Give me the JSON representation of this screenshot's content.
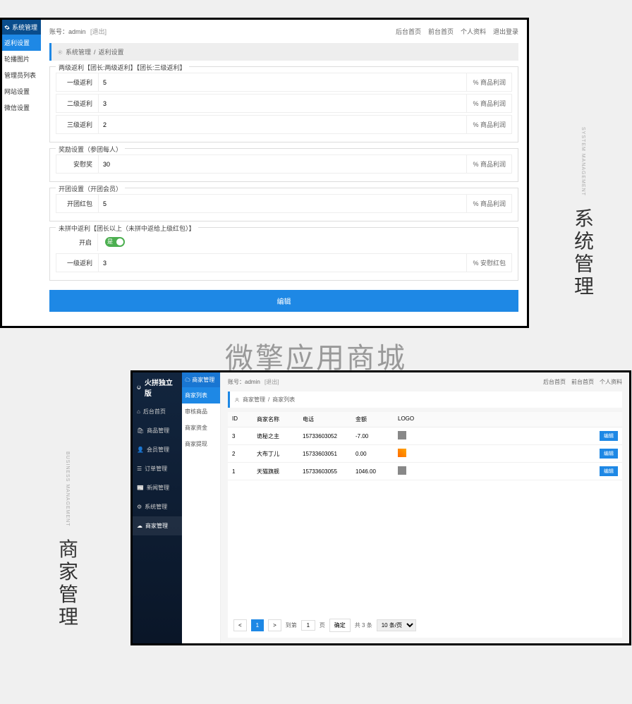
{
  "panel1": {
    "sidebar": {
      "header": "系统管理",
      "items": [
        "返利设置",
        "轮播图片",
        "管理员列表",
        "网站设置",
        "微信设置"
      ]
    },
    "topbar": {
      "account_label": "账号：",
      "account_value": "admin",
      "logout_inline": "[退出]",
      "links": [
        "后台首页",
        "前台首页",
        "个人资料",
        "退出登录"
      ]
    },
    "breadcrumb": [
      "系统管理",
      "返利设置"
    ],
    "section1": {
      "title": "两级返利【团长:两级返利】【团长:三级返利】",
      "rows": [
        {
          "label": "一级返利",
          "value": "5",
          "suffix": "% 商品利润"
        },
        {
          "label": "二级返利",
          "value": "3",
          "suffix": "% 商品利润"
        },
        {
          "label": "三级返利",
          "value": "2",
          "suffix": "% 商品利润"
        }
      ]
    },
    "section2": {
      "title": "奖励设置（参团每人）",
      "rows": [
        {
          "label": "安慰奖",
          "value": "30",
          "suffix": "% 商品利润"
        }
      ]
    },
    "section3": {
      "title": "开团设置（开团会员）",
      "rows": [
        {
          "label": "开团红包",
          "value": "5",
          "suffix": "% 商品利润"
        }
      ]
    },
    "section4": {
      "title": "未拼中返利【团长以上（未拼中返给上级红包）】",
      "toggle_label": "开启",
      "toggle_text": "是",
      "rows": [
        {
          "label": "一级返利",
          "value": "3",
          "suffix": "% 安慰红包"
        }
      ]
    },
    "submit": "编辑"
  },
  "vlabel1": {
    "cn": "系统管理",
    "en": "SYSTEM MANAGEMENT"
  },
  "center_text": "微擎应用商城",
  "panel2": {
    "brand": "火拼独立版",
    "nav": [
      {
        "icon": "home",
        "label": "后台首页"
      },
      {
        "icon": "bag",
        "label": "商品管理"
      },
      {
        "icon": "user",
        "label": "会员管理"
      },
      {
        "icon": "list",
        "label": "订单管理"
      },
      {
        "icon": "news",
        "label": "新闻管理"
      },
      {
        "icon": "gear",
        "label": "系统管理"
      },
      {
        "icon": "cloud",
        "label": "商家管理"
      }
    ],
    "subsidebar": {
      "header": "商家管理",
      "items": [
        "商家列表",
        "审核商品",
        "商家资金",
        "商家提现"
      ]
    },
    "topbar": {
      "account_label": "账号：",
      "account_value": "admin",
      "logout_inline": "[退出]",
      "links": [
        "后台首页",
        "前台首页",
        "个人资料"
      ]
    },
    "breadcrumb": [
      "商家管理",
      "商家列表"
    ],
    "table": {
      "headers": [
        "ID",
        "商家名称",
        "电话",
        "金额",
        "LOGO",
        ""
      ],
      "rows": [
        {
          "id": "3",
          "name": "诡秘之主",
          "phone": "15733603052",
          "amount": "-7.00",
          "logo": "gray",
          "action": "编辑"
        },
        {
          "id": "2",
          "name": "大布丁儿",
          "phone": "15733603051",
          "amount": "0.00",
          "logo": "orange",
          "action": "编辑"
        },
        {
          "id": "1",
          "name": "天猫旗舰",
          "phone": "15733603055",
          "amount": "1046.00",
          "logo": "gray",
          "action": "编辑"
        }
      ]
    },
    "pagination": {
      "prev": "<",
      "current": "1",
      "next": ">",
      "goto_label": "到第",
      "goto_value": "1",
      "page_unit": "页",
      "confirm": "确定",
      "total": "共 3 条",
      "per_page": "10 条/页"
    }
  },
  "vlabel2": {
    "cn": "商家管理",
    "en": "BUSINESS MANAGEMENT"
  }
}
